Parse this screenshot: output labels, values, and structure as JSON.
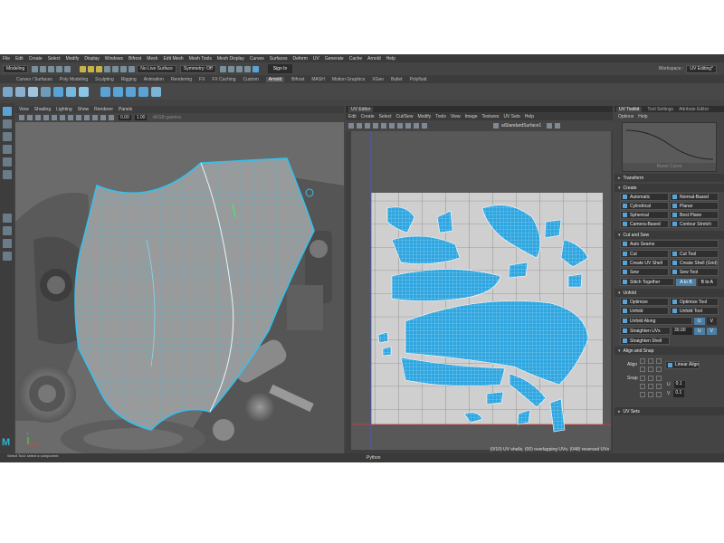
{
  "menubar": [
    "File",
    "Edit",
    "Create",
    "Select",
    "Modify",
    "Display",
    "Windows",
    "Bifrost",
    "Mesh",
    "Edit Mesh",
    "Mesh Tools",
    "Mesh Display",
    "Curves",
    "Surfaces",
    "Deform",
    "UV",
    "Generate",
    "Cache",
    "Arnold",
    "Help"
  ],
  "statusline": {
    "mode": "Modeling",
    "live_surface": "No Live Surface",
    "symmetry": "Symmetry: Off",
    "signin": "Sign In",
    "workspace_label": "Workspace :",
    "workspace_value": "UV Editing*"
  },
  "shelf_tabs": [
    "Curves / Surfaces",
    "Poly Modeling",
    "Sculpting",
    "Rigging",
    "Animation",
    "Rendering",
    "FX",
    "FX Caching",
    "Custom",
    "Arnold",
    "Bifrost",
    "MASH",
    "Motion Graphics",
    "XGen",
    "Bullet",
    "Polyfluid"
  ],
  "shelf_active": "Arnold",
  "viewport": {
    "menu": [
      "View",
      "Shading",
      "Lighting",
      "Show",
      "Renderer",
      "Panels"
    ],
    "near": "0.00",
    "far": "1.00",
    "colorspace": "sRGB gamma",
    "axis_x": "X",
    "axis_y": "Y"
  },
  "uv_editor": {
    "title": "UV Editor",
    "menu": [
      "Edit",
      "Create",
      "Select",
      "Cut/Sew",
      "Modify",
      "Tools",
      "View",
      "Image",
      "Textures",
      "UV Sets",
      "Help"
    ],
    "texture": "aiStandardSurface1",
    "status": "(0/10) UV shells, (00) overlapping UVs, (048) reversed UVs"
  },
  "right_panel": {
    "tabs": [
      "UV Toolkit",
      "Tool Settings",
      "Attribute Editor"
    ],
    "active_tab": "UV Toolkit",
    "submenu": [
      "Options",
      "Help"
    ],
    "reset_curve": "Reset Curve",
    "sections": {
      "transform": "Transform",
      "create": "Create",
      "create_buttons": [
        "Automatic",
        "Normal-Based",
        "Cylindrical",
        "Planar",
        "Spherical",
        "Best Plane",
        "Camera-Based",
        "Contour Stretch"
      ],
      "cut_and_sew": "Cut and Sew",
      "auto_seams": "Auto Seams",
      "cut_buttons": [
        "Cut",
        "Cut Tool",
        "Create UV Shell",
        "Create Shell (Grid)",
        "Sew",
        "Sew Tool"
      ],
      "stitch_together": "Stitch Together",
      "stitch_a_to_b": "A to B",
      "stitch_b_to_a": "B to A",
      "unfold": "Unfold",
      "unfold_buttons": [
        "Optimize",
        "Optimize Tool",
        "Unfold",
        "Unfold Tool"
      ],
      "unfold_along": "Unfold Along",
      "straighten_uvs": "Straighten UVs",
      "straighten_value": "30.00",
      "straighten_shell": "Straighten Shell",
      "u": "U",
      "v": "V",
      "align_snap": "Align and Snap",
      "align": "Align",
      "linear_align": "Linear Align",
      "snap": "Snap",
      "snap_u_value": "0.1",
      "snap_v_value": "0.1",
      "uv_sets": "UV Sets"
    }
  },
  "bottombar": {
    "lang": "Python"
  },
  "tip": "Select Tool: select a component",
  "colors": {
    "accent": "#29b6d9",
    "uv_shell": "#2fa6e0",
    "wireframe": "#35c0ec"
  }
}
